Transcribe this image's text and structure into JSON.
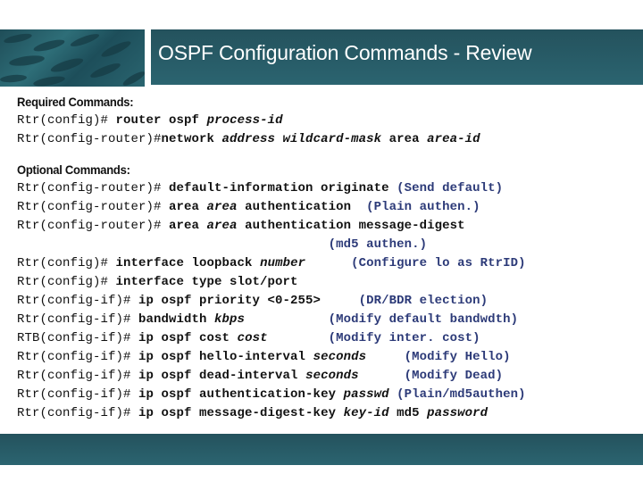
{
  "header": {
    "image": "school-of-fish-photo",
    "title": "OSPF Configuration Commands - Review"
  },
  "required": {
    "heading": "Required Commands:",
    "lines": [
      {
        "prompt": "Rtr(config)# ",
        "parts": [
          {
            "t": "router ospf ",
            "s": "cmd"
          },
          {
            "t": "process-id",
            "s": "arg"
          }
        ]
      },
      {
        "prompt": "Rtr(config-router)#",
        "parts": [
          {
            "t": "network ",
            "s": "cmd"
          },
          {
            "t": "address wildcard-mask",
            "s": "arg"
          },
          {
            "t": " area ",
            "s": "cmd"
          },
          {
            "t": "area-id",
            "s": "arg"
          }
        ]
      }
    ]
  },
  "optional": {
    "heading": "Optional Commands:",
    "lines": [
      {
        "prompt": "Rtr(config-router)# ",
        "parts": [
          {
            "t": "default-information originate ",
            "s": "cmd"
          },
          {
            "t": "(Send default)",
            "s": "note"
          }
        ]
      },
      {
        "prompt": "Rtr(config-router)# ",
        "parts": [
          {
            "t": "area ",
            "s": "cmd"
          },
          {
            "t": "area",
            "s": "arg"
          },
          {
            "t": " authentication  ",
            "s": "cmd"
          },
          {
            "t": "(Plain authen.)",
            "s": "note"
          }
        ]
      },
      {
        "prompt": "Rtr(config-router)# ",
        "parts": [
          {
            "t": "area ",
            "s": "cmd"
          },
          {
            "t": "area",
            "s": "arg"
          },
          {
            "t": " authentication message-digest",
            "s": "cmd"
          }
        ]
      },
      {
        "prompt": "                                        ",
        "parts": [
          {
            "t": " (md5 authen.)",
            "s": "note"
          }
        ]
      },
      {
        "prompt": "Rtr(config)# ",
        "parts": [
          {
            "t": "interface loopback ",
            "s": "cmd"
          },
          {
            "t": "number",
            "s": "arg"
          },
          {
            "t": "      ",
            "s": "cmd"
          },
          {
            "t": "(Configure lo as RtrID)",
            "s": "note"
          }
        ]
      },
      {
        "prompt": "Rtr(config)# ",
        "parts": [
          {
            "t": "interface type slot/port",
            "s": "cmd"
          }
        ]
      },
      {
        "prompt": "Rtr(config-if)# ",
        "parts": [
          {
            "t": "ip ospf priority <0-255>     ",
            "s": "cmd"
          },
          {
            "t": "(DR/BDR election)",
            "s": "note"
          }
        ]
      },
      {
        "prompt": "Rtr(config-if)# ",
        "parts": [
          {
            "t": "bandwidth ",
            "s": "cmd"
          },
          {
            "t": "kbps",
            "s": "arg"
          },
          {
            "t": "           ",
            "s": "cmd"
          },
          {
            "t": "(Modify default bandwdth)",
            "s": "note"
          }
        ]
      },
      {
        "prompt": "RTB(config-if)# ",
        "parts": [
          {
            "t": "ip ospf cost ",
            "s": "cmd"
          },
          {
            "t": "cost",
            "s": "arg"
          },
          {
            "t": "        ",
            "s": "cmd"
          },
          {
            "t": "(Modify inter. cost)",
            "s": "note"
          }
        ]
      },
      {
        "prompt": "Rtr(config-if)# ",
        "parts": [
          {
            "t": "ip ospf hello-interval ",
            "s": "cmd"
          },
          {
            "t": "seconds",
            "s": "arg"
          },
          {
            "t": "     ",
            "s": "cmd"
          },
          {
            "t": "(Modify Hello)",
            "s": "note"
          }
        ]
      },
      {
        "prompt": "Rtr(config-if)# ",
        "parts": [
          {
            "t": "ip ospf dead-interval ",
            "s": "cmd"
          },
          {
            "t": "seconds",
            "s": "arg"
          },
          {
            "t": "      ",
            "s": "cmd"
          },
          {
            "t": "(Modify Dead)",
            "s": "note"
          }
        ]
      },
      {
        "prompt": "Rtr(config-if)# ",
        "parts": [
          {
            "t": "ip ospf authentication-key ",
            "s": "cmd"
          },
          {
            "t": "passwd",
            "s": "arg"
          },
          {
            "t": " ",
            "s": "cmd"
          },
          {
            "t": "(Plain/md5authen)",
            "s": "note"
          }
        ]
      },
      {
        "prompt": "Rtr(config-if)# ",
        "parts": [
          {
            "t": "ip ospf message-digest-key ",
            "s": "cmd"
          },
          {
            "t": "key-id",
            "s": "arg"
          },
          {
            "t": " md5 ",
            "s": "cmd"
          },
          {
            "t": "password",
            "s": "arg"
          }
        ]
      }
    ]
  },
  "colors": {
    "banner": "#24525d",
    "note": "#2c3a78",
    "text": "#111111"
  }
}
